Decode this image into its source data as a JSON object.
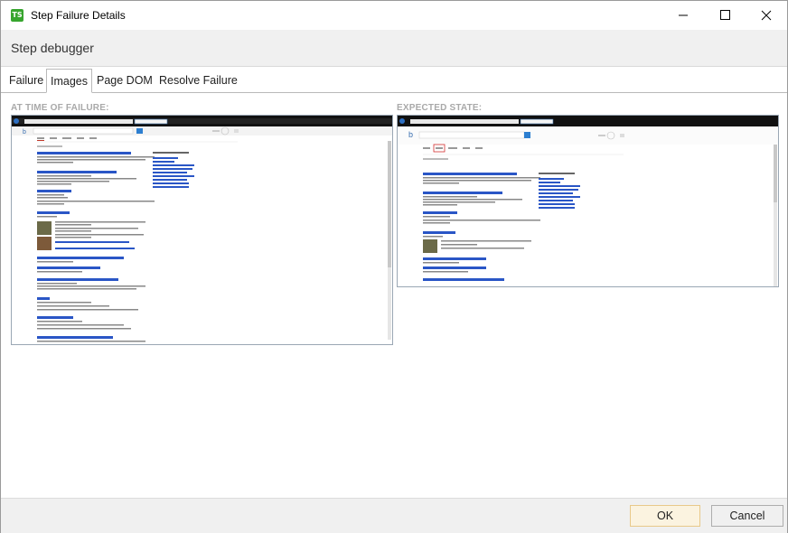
{
  "window": {
    "title": "Step Failure Details",
    "app_icon_text": "TS"
  },
  "header": {
    "title": "Step debugger"
  },
  "tabs": [
    {
      "label": "Failure",
      "active": false
    },
    {
      "label": "Images",
      "active": true
    },
    {
      "label": "Page DOM",
      "active": false
    },
    {
      "label": "Resolve Failure",
      "active": false
    }
  ],
  "panels": {
    "failure_label": "AT TIME OF FAILURE:",
    "expected_label": "EXPECTED STATE:"
  },
  "footer": {
    "ok_label": "OK",
    "cancel_label": "Cancel"
  },
  "colors": {
    "accent_ok_bg": "#fbf3e0",
    "app_icon": "#37a52e"
  }
}
